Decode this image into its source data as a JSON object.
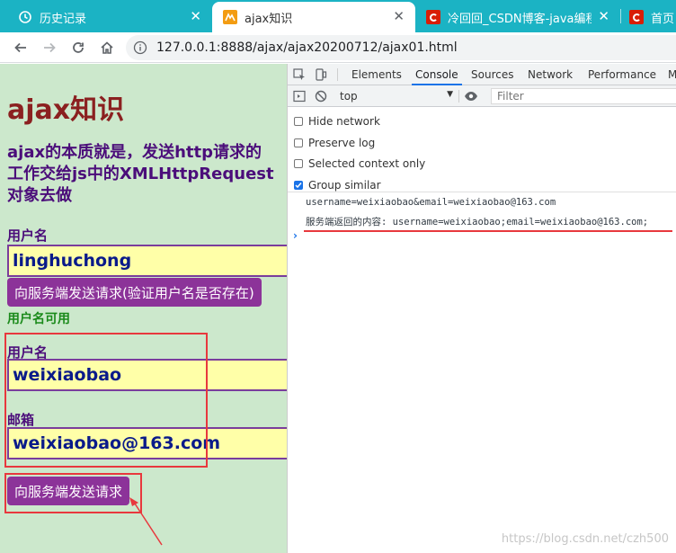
{
  "tabs": [
    {
      "label": "历史记录",
      "icon": "history-icon"
    },
    {
      "label": "ajax知识",
      "icon": "page-favicon-icon"
    },
    {
      "label": "冷回回_CSDN博客-java编程,ja",
      "icon": "csdn-favicon-icon"
    },
    {
      "label": "首页 -",
      "icon": "csdn-favicon-icon"
    }
  ],
  "address": {
    "url": "127.0.0.1:8888/ajax/ajax20200712/ajax01.html"
  },
  "page": {
    "title": "ajax知识",
    "description": "ajax的本质就是，发送http请求的工作交给js中的XMLHttpRequest对象去做",
    "username_label_1": "用户名",
    "username_value_1": "linghuchong",
    "check_button": "向服务端发送请求(验证用户名是否存在)",
    "status_text": "用户名可用",
    "username_label_2": "用户名",
    "username_value_2": "weixiaobao",
    "email_label": "邮箱",
    "email_value": "weixiaobao@163.com",
    "send_button": "向服务端发送请求"
  },
  "devtools": {
    "tabs": [
      "Elements",
      "Console",
      "Sources",
      "Network",
      "Performance",
      "M"
    ],
    "active_tab": "Console",
    "context": "top",
    "filter_placeholder": "Filter",
    "settings": [
      {
        "label": "Hide network",
        "checked": false
      },
      {
        "label": "Preserve log",
        "checked": false
      },
      {
        "label": "Selected context only",
        "checked": false
      },
      {
        "label": "Group similar",
        "checked": true
      }
    ],
    "console_lines": [
      "username=weixiaobao&email=weixiaobao@163.com",
      "服务端返回的内容: username=weixiaobao;email=weixiaobao@163.com;"
    ]
  },
  "watermark": "https://blog.csdn.net/czh500",
  "colors": {
    "tab_strip": "#1bb3c4",
    "page_bg": "#cce8cc",
    "title": "#8b2020",
    "text_purple": "#4b0d7a",
    "input_bg": "#ffffa8",
    "button_bg": "#8c3399",
    "annotation_red": "#e8383d",
    "status_green": "#1a8a1a"
  }
}
